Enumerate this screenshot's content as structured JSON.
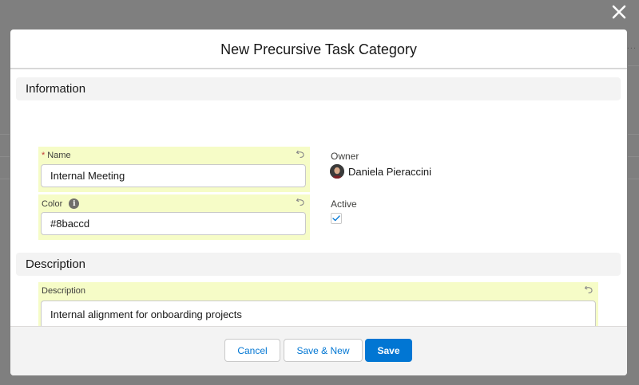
{
  "modal": {
    "title": "New Precursive Task Category"
  },
  "sections": {
    "information": "Information",
    "description": "Description"
  },
  "fields": {
    "name": {
      "label": "Name",
      "required_marker": "*",
      "value": "Internal Meeting"
    },
    "color": {
      "label": "Color",
      "value": "#8baccd"
    },
    "owner": {
      "label": "Owner",
      "value": "Daniela Pieraccini"
    },
    "active": {
      "label": "Active",
      "checked": true
    },
    "description": {
      "label": "Description",
      "value": "Internal alignment for onboarding projects"
    }
  },
  "footer": {
    "cancel_label": "Cancel",
    "save_new_label": "Save & New",
    "save_label": "Save"
  },
  "background": {
    "overflow_dots": "..."
  },
  "icons": {
    "close": "close-icon",
    "undo": "undo-icon",
    "info": "info-icon",
    "check": "check-icon",
    "resize": "resize-grip-icon"
  },
  "colors": {
    "brand": "#0176d3",
    "edited_field_highlight": "#f6fcc7",
    "required": "#c23934",
    "section_header": "#f3f3f3",
    "overlay": "#7f7f7f"
  }
}
